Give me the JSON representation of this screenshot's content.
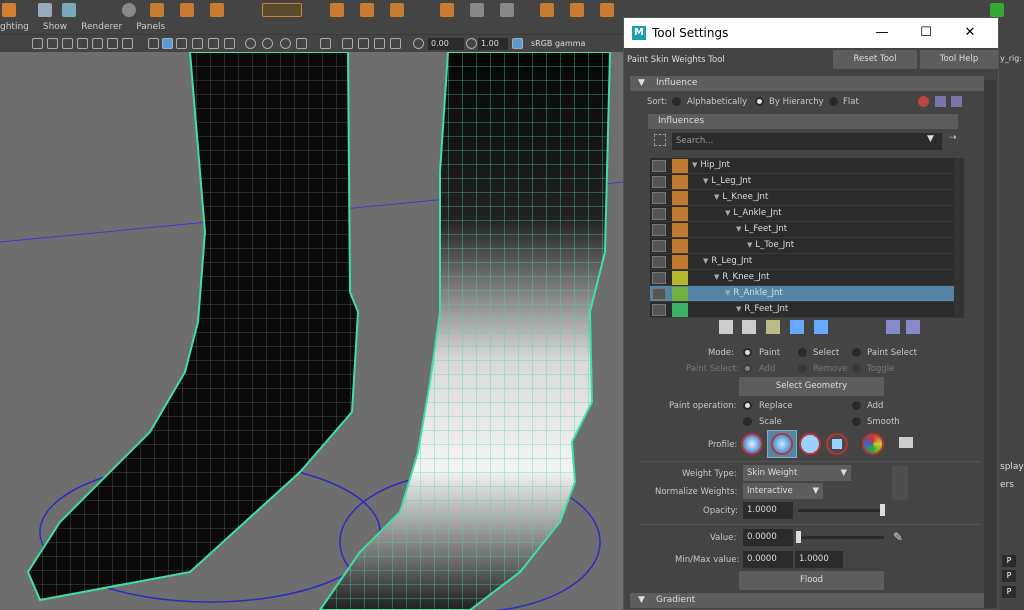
{
  "menubar": {
    "items": [
      "ghting",
      "Show",
      "Renderer",
      "Panels"
    ]
  },
  "viewport_toolbar": {
    "exposure": "0.00",
    "gamma": "1.00",
    "color_space": "sRGB gamma"
  },
  "right_strip": {
    "texts": [
      "splay",
      "ers",
      "y_rig:"
    ],
    "p_labels": [
      "P",
      "P",
      "P"
    ]
  },
  "tool_settings": {
    "window_title": "Tool Settings",
    "tool_name": "Paint Skin Weights Tool",
    "reset_tool": "Reset Tool",
    "tool_help": "Tool Help",
    "influence_section": "Influence",
    "sort_label": "Sort:",
    "sort_options": [
      "Alphabetically",
      "By Hierarchy",
      "Flat"
    ],
    "sort_selected": 1,
    "influences_header": "Influences",
    "search_placeholder": "Search...",
    "joints": [
      {
        "name": "Hip_Jnt",
        "color": "#c07a30",
        "depth": 0,
        "selected": false
      },
      {
        "name": "L_Leg_Jnt",
        "color": "#c07a30",
        "depth": 1,
        "selected": false
      },
      {
        "name": "L_Knee_Jnt",
        "color": "#c07a30",
        "depth": 2,
        "selected": false
      },
      {
        "name": "L_Ankle_Jnt",
        "color": "#c07a30",
        "depth": 3,
        "selected": false
      },
      {
        "name": "L_Feet_Jnt",
        "color": "#c07a30",
        "depth": 4,
        "selected": false
      },
      {
        "name": "L_Toe_Jnt",
        "color": "#c07a30",
        "depth": 5,
        "selected": false
      },
      {
        "name": "R_Leg_Jnt",
        "color": "#c07a30",
        "depth": 1,
        "selected": false
      },
      {
        "name": "R_Knee_Jnt",
        "color": "#b8b830",
        "depth": 2,
        "selected": false
      },
      {
        "name": "R_Ankle_Jnt",
        "color": "#70b040",
        "depth": 3,
        "selected": true
      },
      {
        "name": "R_Feet_Jnt",
        "color": "#3ab060",
        "depth": 4,
        "selected": false
      }
    ],
    "mode_label": "Mode:",
    "mode_options": [
      "Paint",
      "Select",
      "Paint Select"
    ],
    "paint_select_label": "Paint Select:",
    "paint_select_options": [
      "Add",
      "Remove",
      "Toggle"
    ],
    "select_geometry": "Select Geometry",
    "paint_operation_label": "Paint operation:",
    "paint_operations": [
      "Replace",
      "Add",
      "Scale",
      "Smooth"
    ],
    "profile_label": "Profile:",
    "weight_type_label": "Weight Type:",
    "weight_type_value": "Skin Weight",
    "normalize_label": "Normalize Weights:",
    "normalize_value": "Interactive",
    "opacity_label": "Opacity:",
    "opacity_value": "1.0000",
    "value_label": "Value:",
    "value_value": "0.0000",
    "minmax_label": "Min/Max value:",
    "min_value": "0.0000",
    "max_value": "1.0000",
    "flood": "Flood",
    "gradient_section": "Gradient"
  }
}
